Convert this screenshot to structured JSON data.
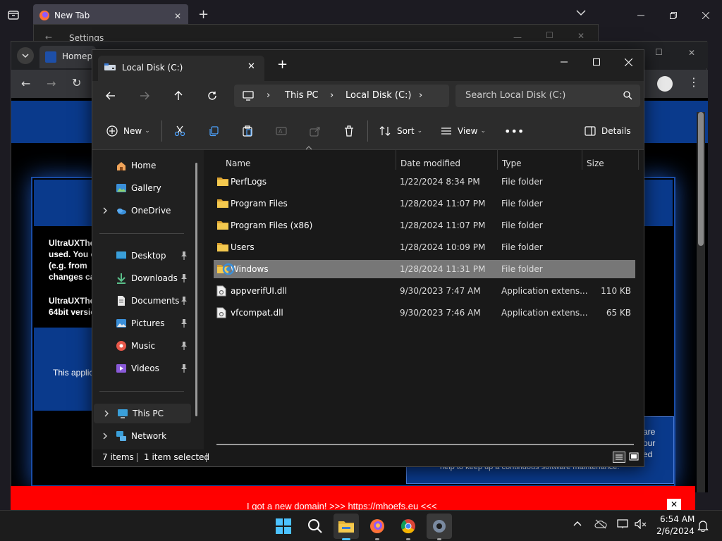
{
  "browser": {
    "tab_title": "New Tab",
    "settings_title": "Settings",
    "cr_tab_title": "Homepa"
  },
  "webpage": {
    "text_block_1": [
      "UltraUXThe",
      "used. You c",
      "(e.g. from ",
      "changes ca"
    ],
    "text_block_2": [
      "UltraUXThe",
      "64bit versio"
    ],
    "text_block_3": "This applic",
    "right_fragments": [
      "are",
      "our",
      "ed"
    ],
    "bottom_text": "help to keep up a continuous software maintenance.",
    "banner_text": "I got a new domain! >>> https://mhoefs.eu <<<"
  },
  "explorer": {
    "tab_title": "Local Disk (C:)",
    "breadcrumbs": [
      "This PC",
      "Local Disk (C:)"
    ],
    "search_placeholder": "Search Local Disk (C:)",
    "commands": {
      "new": "New",
      "sort": "Sort",
      "view": "View",
      "details": "Details"
    },
    "nav_pane": [
      {
        "label": "Home",
        "icon": "home-icon"
      },
      {
        "label": "Gallery",
        "icon": "gallery-icon"
      },
      {
        "label": "OneDrive",
        "icon": "onedrive-icon"
      },
      {
        "label": "Desktop",
        "icon": "desktop-icon"
      },
      {
        "label": "Downloads",
        "icon": "downloads-icon"
      },
      {
        "label": "Documents",
        "icon": "documents-icon"
      },
      {
        "label": "Pictures",
        "icon": "pictures-icon"
      },
      {
        "label": "Music",
        "icon": "music-icon"
      },
      {
        "label": "Videos",
        "icon": "videos-icon"
      },
      {
        "label": "This PC",
        "icon": "this-pc-icon"
      },
      {
        "label": "Network",
        "icon": "network-icon"
      }
    ],
    "columns": [
      "Name",
      "Date modified",
      "Type",
      "Size"
    ],
    "files": [
      {
        "name": "PerfLogs",
        "date": "1/22/2024 8:34 PM",
        "type": "File folder",
        "size": "",
        "kind": "folder"
      },
      {
        "name": "Program Files",
        "date": "1/28/2024 11:07 PM",
        "type": "File folder",
        "size": "",
        "kind": "folder"
      },
      {
        "name": "Program Files (x86)",
        "date": "1/28/2024 11:07 PM",
        "type": "File folder",
        "size": "",
        "kind": "folder"
      },
      {
        "name": "Users",
        "date": "1/28/2024 10:09 PM",
        "type": "File folder",
        "size": "",
        "kind": "folder"
      },
      {
        "name": "Windows",
        "date": "1/28/2024 11:31 PM",
        "type": "File folder",
        "size": "",
        "kind": "folder",
        "selected": true
      },
      {
        "name": "appverifUI.dll",
        "date": "9/30/2023 7:47 AM",
        "type": "Application extens...",
        "size": "110 KB",
        "kind": "dll"
      },
      {
        "name": "vfcompat.dll",
        "date": "9/30/2023 7:46 AM",
        "type": "Application extens...",
        "size": "65 KB",
        "kind": "dll"
      }
    ],
    "status": {
      "count": "7 items",
      "selection": "1 item selected"
    }
  },
  "taskbar": {
    "time": "6:54 AM",
    "date": "2/6/2024"
  },
  "colors": {
    "accent": "#0a3a8c",
    "banner": "#ff0000",
    "folder": "#e8b739",
    "selection": "#777777"
  }
}
